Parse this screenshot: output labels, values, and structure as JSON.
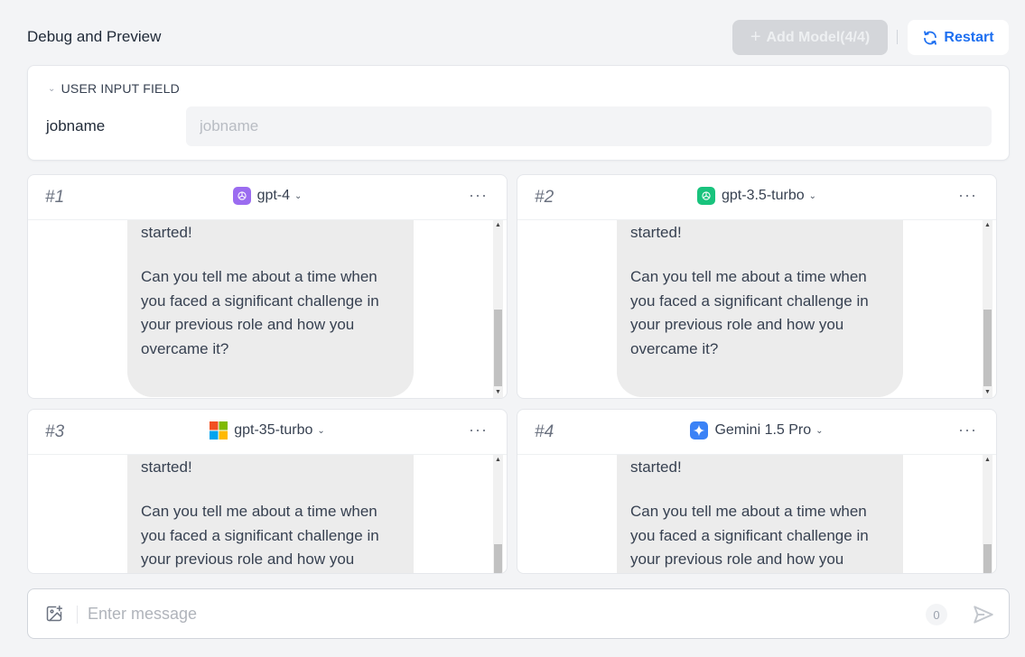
{
  "header": {
    "title": "Debug and Preview",
    "add_model_label": "Add Model(4/4)",
    "restart_label": "Restart"
  },
  "input_section": {
    "toggle_label": "USER INPUT FIELD",
    "fields": [
      {
        "label": "jobname",
        "value": "",
        "placeholder": "jobname"
      }
    ]
  },
  "panels": [
    {
      "number": "#1",
      "model": "gpt-4",
      "icon": "openai-icon",
      "icon_color": "#9b6cf0",
      "message_line1": "started!",
      "message_para": "Can you tell me about a time when you faced a significant challenge in your previous role and how you overcame it?"
    },
    {
      "number": "#2",
      "model": "gpt-3.5-turbo",
      "icon": "openai-icon",
      "icon_color": "#19c37d",
      "message_line1": "started!",
      "message_para": "Can you tell me about a time when you faced a significant challenge in your previous role and how you overcame it?"
    },
    {
      "number": "#3",
      "model": "gpt-35-turbo",
      "icon": "microsoft-icon",
      "icon_color": "#f25022",
      "message_line1": "started!",
      "message_para": "Can you tell me about a time when you faced a significant challenge in your previous role and how you overcame it?"
    },
    {
      "number": "#4",
      "model": "Gemini 1.5 Pro",
      "icon": "gemini-icon",
      "icon_color": "#3b82f6",
      "message_line1": "started!",
      "message_para": "Can you tell me about a time when you faced a significant challenge in your previous role and how you overcame it?"
    }
  ],
  "composer": {
    "placeholder": "Enter message",
    "value": "",
    "char_count": "0"
  },
  "colors": {
    "accent": "#1d6ff0",
    "bubble": "#ececec",
    "background": "#f3f4f6"
  }
}
